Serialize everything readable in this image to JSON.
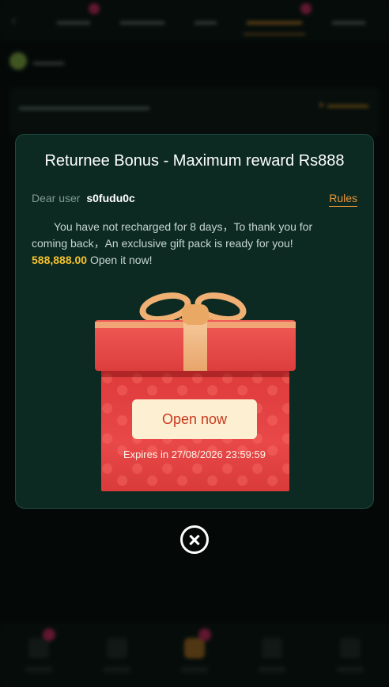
{
  "modal": {
    "title": "Returnee Bonus - Maximum reward Rs888",
    "greeting_prefix": "Dear user",
    "username": "s0fudu0c",
    "rules_label": "Rules",
    "message_part1": "You have not recharged for 8 days，To thank you for coming back，An exclusive gift pack is ready for you!",
    "amount": "588,888.00",
    "message_part2": "Open it now!",
    "open_button_label": "Open now",
    "expires_text": "Expires in 27/08/2026 23:59:59"
  },
  "icons": {
    "close": "close-circle-icon",
    "gift": "gift-box-icon"
  },
  "colors": {
    "modal_bg": "#0c2a22",
    "accent_orange": "#e7963a",
    "amount_gold": "#f5c12e",
    "button_text": "#c8391f",
    "button_bg": "#fdf0d2"
  }
}
